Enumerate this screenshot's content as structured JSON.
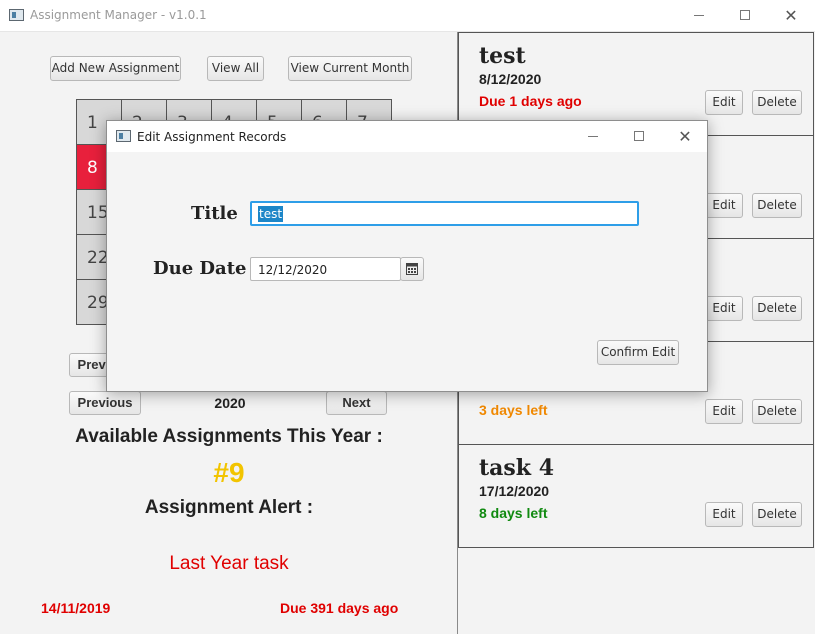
{
  "window": {
    "title": "Assignment Manager - v1.0.1",
    "controls": [
      "–",
      "☐",
      "✕"
    ]
  },
  "toolbar": {
    "add_label": "Add New Assignment",
    "view_all_label": "View All",
    "view_month_label": "View Current Month"
  },
  "calendar": {
    "days": [
      "1",
      "2",
      "3",
      "4",
      "5",
      "6",
      "7",
      "8",
      "",
      "",
      "",
      "",
      "",
      "",
      "15",
      "",
      "",
      "",
      "",
      "",
      "",
      "22",
      "",
      "",
      "",
      "",
      "",
      "",
      "29",
      "",
      "",
      "",
      "",
      "",
      ""
    ],
    "highlight_day": "8"
  },
  "month_nav": {
    "prev_label": "Previous"
  },
  "year_nav": {
    "prev_label": "Previous",
    "year": "2020",
    "next_label": "Next"
  },
  "summary": {
    "available_label": "Available Assignments This Year :",
    "count": "#9",
    "alert_label": "Assignment Alert :",
    "alert_title": "Last Year task",
    "alert_date": "14/11/2019",
    "alert_status": "Due 391 days ago"
  },
  "assignments": [
    {
      "title": "test",
      "date": "8/12/2020",
      "status": "Due 1 days ago",
      "color": "#e00000"
    },
    {
      "title": "",
      "date": "",
      "status": "",
      "color": "#222222"
    },
    {
      "title": "",
      "date": "",
      "status": "",
      "color": "#222222"
    },
    {
      "title": "",
      "date": "",
      "status": "3 days left",
      "color": "#f08800"
    },
    {
      "title": "task 4",
      "date": "17/12/2020",
      "status": "8 days left",
      "color": "#108a10"
    }
  ],
  "card_buttons": {
    "edit_label": "Edit",
    "delete_label": "Delete"
  },
  "dialog": {
    "title": "Edit Assignment Records",
    "title_label": "Title",
    "title_value": "test",
    "due_label": "Due Date",
    "due_value": "12/12/2020",
    "confirm_label": "Confirm Edit"
  },
  "colors": {
    "highlight": "#e8203c",
    "count": "#f2c400",
    "alert": "#e00000",
    "selection": "#1c86c8"
  }
}
